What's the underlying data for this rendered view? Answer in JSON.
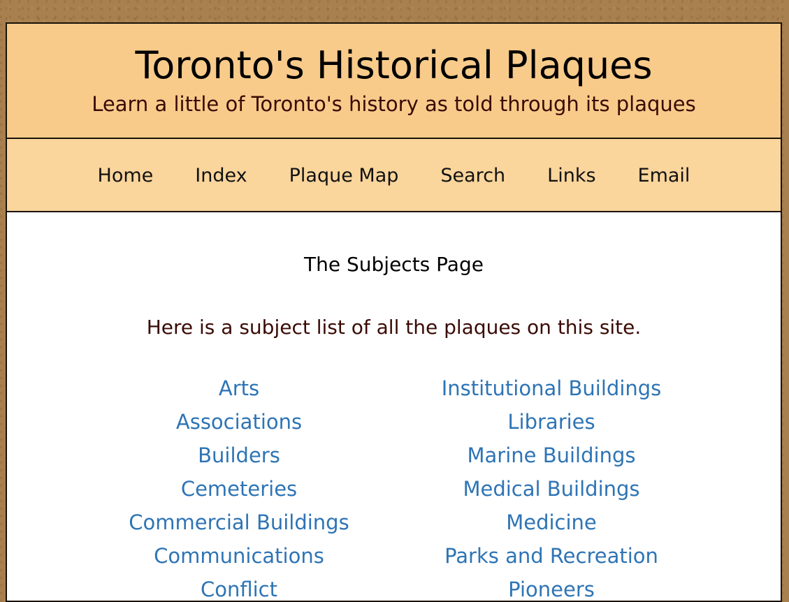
{
  "header": {
    "title": "Toronto's Historical Plaques",
    "subtitle": "Learn a little of Toronto's history as told through its plaques"
  },
  "nav": {
    "items": [
      {
        "label": "Home"
      },
      {
        "label": "Index"
      },
      {
        "label": "Plaque Map"
      },
      {
        "label": "Search"
      },
      {
        "label": "Links"
      },
      {
        "label": "Email"
      }
    ]
  },
  "main": {
    "heading": "The Subjects Page",
    "intro": "Here is a subject list of all the plaques on this site.",
    "subjects_left": [
      "Arts",
      "Associations",
      "Builders",
      "Cemeteries",
      "Commercial Buildings",
      "Communications",
      "Conflict"
    ],
    "subjects_right": [
      "Institutional Buildings",
      "Libraries",
      "Marine Buildings",
      "Medical Buildings",
      "Medicine",
      "Parks and Recreation",
      "Pioneers"
    ]
  },
  "colors": {
    "header_bg": "#f8cb8b",
    "nav_bg": "#fad59c",
    "link": "#2e74b5",
    "subtitle_text": "#3a0b05"
  }
}
